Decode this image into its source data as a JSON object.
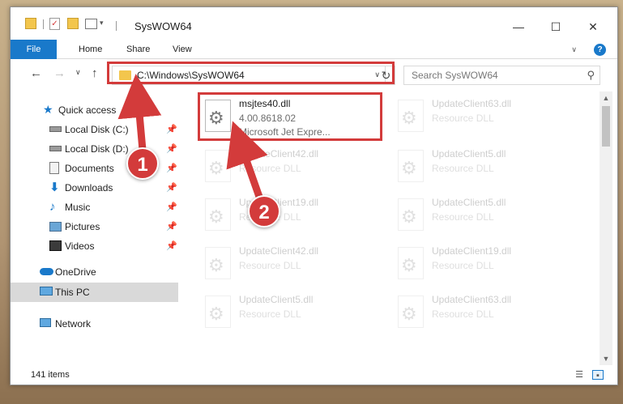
{
  "window": {
    "title": "SysWOW64",
    "controls": {
      "minimize": "—",
      "maximize": "☐",
      "close": "✕"
    }
  },
  "ribbon": {
    "tabs": [
      {
        "label": "File"
      },
      {
        "label": "Home"
      },
      {
        "label": "Share"
      },
      {
        "label": "View"
      }
    ],
    "help_label": "?"
  },
  "navigation": {
    "address": "C:\\Windows\\SysWOW64",
    "search_placeholder": "Search SysWOW64"
  },
  "sidebar": {
    "items": [
      {
        "label": "Quick access",
        "icon": "star-icon",
        "pinned": false
      },
      {
        "label": "Local Disk (C:)",
        "icon": "drive-icon",
        "pinned": true
      },
      {
        "label": "Local Disk (D:)",
        "icon": "drive-icon",
        "pinned": true
      },
      {
        "label": "Documents",
        "icon": "documents-icon",
        "pinned": true
      },
      {
        "label": "Downloads",
        "icon": "download-icon",
        "pinned": true
      },
      {
        "label": "Music",
        "icon": "music-icon",
        "pinned": true
      },
      {
        "label": "Pictures",
        "icon": "pictures-icon",
        "pinned": true
      },
      {
        "label": "Videos",
        "icon": "videos-icon",
        "pinned": true
      },
      {
        "label": "OneDrive",
        "icon": "cloud-icon",
        "pinned": false
      },
      {
        "label": "This PC",
        "icon": "computer-icon",
        "pinned": false,
        "selected": true
      },
      {
        "label": "Network",
        "icon": "network-icon",
        "pinned": false
      }
    ]
  },
  "files": [
    {
      "name": "msjtes40.dll",
      "line2": "4.00.8618.02",
      "line3": "Microsoft Jet Expre...",
      "faded": false
    },
    {
      "name": "UpdateClient63.dll",
      "line2": "Resource DLL",
      "faded": true
    },
    {
      "name": "UpdateClient42.dll",
      "line2": "Resource DLL",
      "faded": true
    },
    {
      "name": "UpdateClient5.dll",
      "line2": "Resource DLL",
      "faded": true
    },
    {
      "name": "UpdateClient19.dll",
      "line2": "Resource DLL",
      "faded": true
    },
    {
      "name": "UpdateClient5.dll",
      "line2": "Resource DLL",
      "faded": true
    },
    {
      "name": "UpdateClient42.dll",
      "line2": "Resource DLL",
      "faded": true
    },
    {
      "name": "UpdateClient19.dll",
      "line2": "Resource DLL",
      "faded": true
    },
    {
      "name": "UpdateClient5.dll",
      "line2": "Resource DLL",
      "faded": true
    },
    {
      "name": "UpdateClient63.dll",
      "line2": "Resource DLL",
      "faded": true
    }
  ],
  "status": {
    "item_count": "141 items"
  },
  "callouts": [
    {
      "number": "1"
    },
    {
      "number": "2"
    }
  ],
  "colors": {
    "accent": "#1979ca",
    "highlight": "#d33b3b",
    "folder": "#f3c64d"
  }
}
